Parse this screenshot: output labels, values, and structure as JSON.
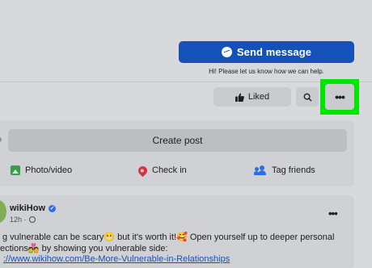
{
  "header": {
    "send_message_label": "Send message",
    "help_text": "Hi! Please let us know how we can help.",
    "liked_label": "Liked",
    "more_label": "•••"
  },
  "composer": {
    "create_post_label": "Create post",
    "actions": {
      "photo_video": "Photo/video",
      "check_in": "Check in",
      "tag_friends": "Tag friends"
    }
  },
  "post": {
    "author": "wikiHow",
    "time": "12h ·",
    "more_label": "•••",
    "line1": "g vulnerable can be scary😬 but it's worth it!🥰 Open yourself up to deeper personal",
    "line2": "ections💑 by showing you vulnerable side:",
    "link": "://www.wikihow.com/Be-More-Vulnerable-in-Relationships"
  },
  "colors": {
    "primary": "#1451b8",
    "highlight": "#00e600",
    "background": "#d7d9dd",
    "button_gray": "#c9cbcf"
  }
}
